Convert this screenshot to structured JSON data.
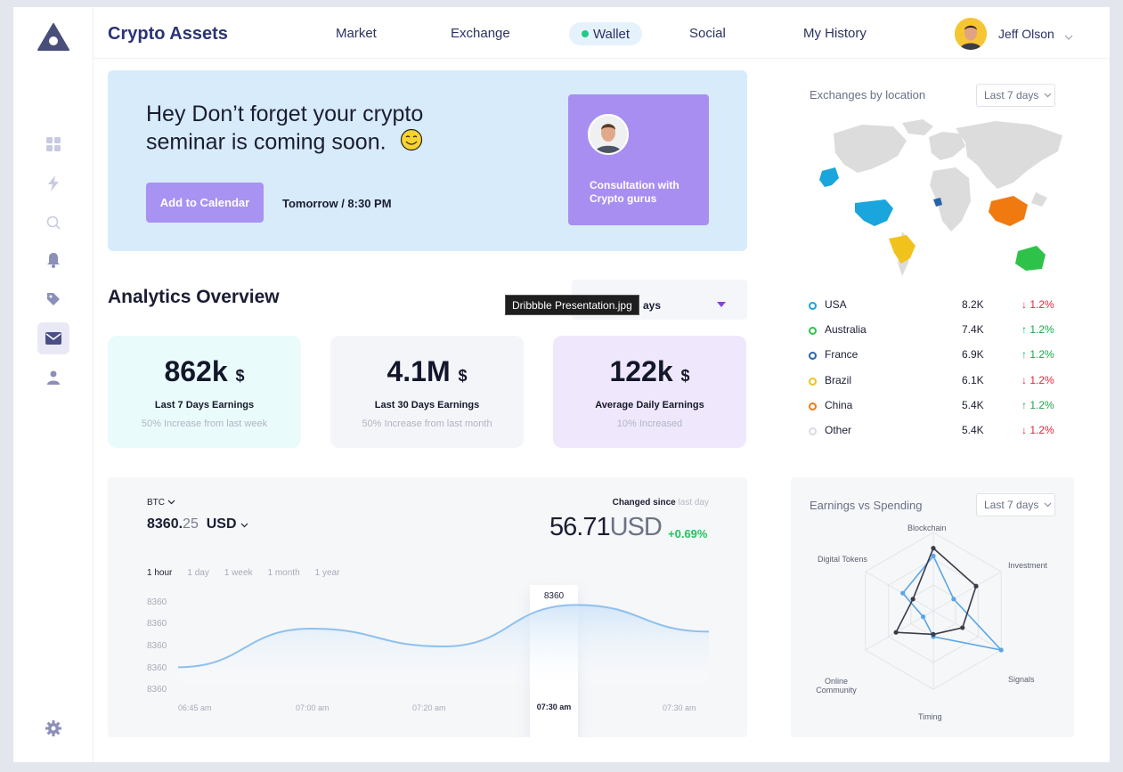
{
  "app": {
    "title": "Crypto Assets"
  },
  "nav": {
    "items": [
      "Market",
      "Exchange",
      "Wallet",
      "Social",
      "My History"
    ],
    "active": "Wallet"
  },
  "user": {
    "name": "Jeff Olson"
  },
  "sidebar": {
    "icons": [
      "dashboard-icon",
      "lightning-icon",
      "search-icon",
      "bell-icon",
      "tag-icon",
      "mail-icon",
      "user-icon",
      "settings-icon"
    ],
    "active": "mail-icon"
  },
  "banner": {
    "line1": "Hey Don’t forget your crypto",
    "line2": "seminar is coming soon.",
    "button": "Add to Calendar",
    "time": "Tomorrow / 8:30 PM",
    "consult_line1": "Consultation with",
    "consult_line2": "Crypto gurus"
  },
  "analytics": {
    "title": "Analytics Overview",
    "dropdown_visible": "ays",
    "tooltip": "Dribbble Presentation.jpg",
    "stats": [
      {
        "value": "862k",
        "unit": "$",
        "label": "Last 7 Days Earnings",
        "sub": "50% Increase from last week",
        "bg": "#eafbfb"
      },
      {
        "value": "4.1M",
        "unit": "$",
        "label": "Last 30 Days Earnings",
        "sub": "50% Increase from last month",
        "bg": "#f4f5f9"
      },
      {
        "value": "122k",
        "unit": "$",
        "label": "Average Daily Earnings",
        "sub": "10% Increased",
        "bg": "#efe8fd"
      }
    ]
  },
  "btc": {
    "coin": "BTC",
    "price_main": "8360.",
    "price_dec": "25",
    "currency": "USD",
    "changed_label": "Changed since",
    "changed_when": "last day",
    "big_value": "56.71",
    "big_unit": "USD",
    "big_pct": "+0.69%",
    "ranges": [
      "1 hour",
      "1 day",
      "1 week",
      "1 month",
      "1 year"
    ],
    "active_range": "1 hour",
    "highlight_value": "8360",
    "highlight_time": "07:30 am"
  },
  "chart_data": {
    "type": "area",
    "title": "",
    "xlabel": "",
    "ylabel": "",
    "x": [
      "06:45 am",
      "07:00 am",
      "07:20 am",
      "07:30 am",
      "07:30 am"
    ],
    "y_ticks": [
      "8360",
      "8360",
      "8360",
      "8360",
      "8360"
    ],
    "series": [
      {
        "values": [
          8360.05,
          8360.18,
          8360.12,
          8360.26,
          8360.17
        ]
      }
    ],
    "grid": false,
    "color": "#8fc0ee"
  },
  "exchanges": {
    "title": "Exchanges by location",
    "range": "Last 7 days",
    "rows": [
      {
        "name": "USA",
        "value": "8.2K",
        "pct": "1.2%",
        "dir": "down",
        "color": "#1aa5dc"
      },
      {
        "name": "Australia",
        "value": "7.4K",
        "pct": "1.2%",
        "dir": "up",
        "color": "#2fc24a"
      },
      {
        "name": "France",
        "value": "6.9K",
        "pct": "1.2%",
        "dir": "up",
        "color": "#2864a8"
      },
      {
        "name": "Brazil",
        "value": "6.1K",
        "pct": "1.2%",
        "dir": "down",
        "color": "#f2c21c"
      },
      {
        "name": "China",
        "value": "5.4K",
        "pct": "1.2%",
        "dir": "up",
        "color": "#f07a10"
      },
      {
        "name": "Other",
        "value": "5.4K",
        "pct": "1.2%",
        "dir": "down",
        "color": "#d9dbe2"
      }
    ]
  },
  "spending": {
    "title": "Earnings vs Spending",
    "range": "Last 7 days",
    "axes": [
      "Blockchain",
      "Investment",
      "Signals",
      "Timing",
      "Online Community",
      "Digital Tokens"
    ],
    "earnings": [
      0.8,
      0.63,
      0.43,
      0.3,
      0.55,
      0.3
    ],
    "spending": [
      0.7,
      0.3,
      1.0,
      0.33,
      0.15,
      0.45
    ]
  }
}
